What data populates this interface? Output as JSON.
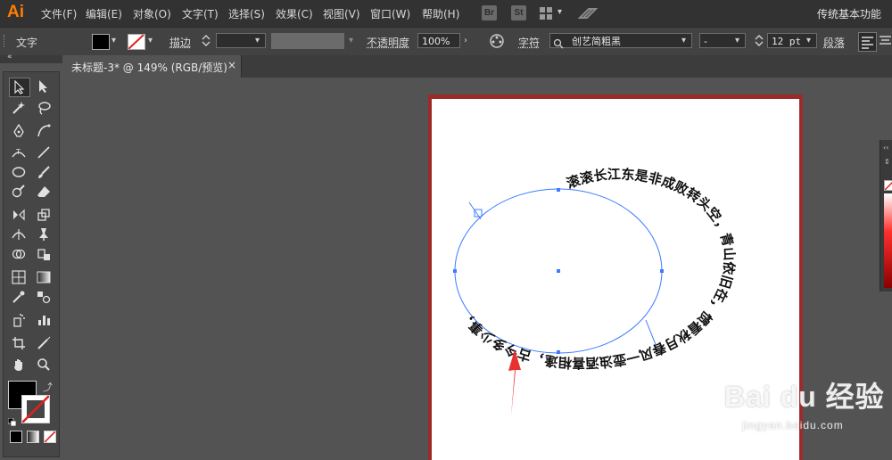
{
  "app": {
    "logo": "Ai",
    "workspace": "传统基本功能"
  },
  "menu": [
    "文件(F)",
    "编辑(E)",
    "对象(O)",
    "文字(T)",
    "选择(S)",
    "效果(C)",
    "视图(V)",
    "窗口(W)",
    "帮助(H)"
  ],
  "app_buttons": [
    "Br",
    "St"
  ],
  "control": {
    "tool_label": "文字",
    "stroke_label": "描边",
    "opacity_label": "不透明度",
    "opacity_value": "100%",
    "char_label": "字符",
    "font_name": "创艺简粗黑",
    "font_size": "12 pt",
    "para_label": "段落"
  },
  "tab": {
    "title": "未标题-3* @ 149% (RGB/预览)",
    "close": "×"
  },
  "canvas": {
    "path_text": "滚滚长江东是非成败转头空，青山依旧在，惯看秋月春风一壶浊酒喜相逢，古今多少事，",
    "anchor_color": "#4a7cff",
    "arrow_color": "#e8322f"
  },
  "watermark": {
    "brand": "Bai du 经验",
    "url": "jingyan.baidu.com"
  },
  "colors": {
    "accent": "#ff7c00",
    "selection": "#3d7bff"
  }
}
